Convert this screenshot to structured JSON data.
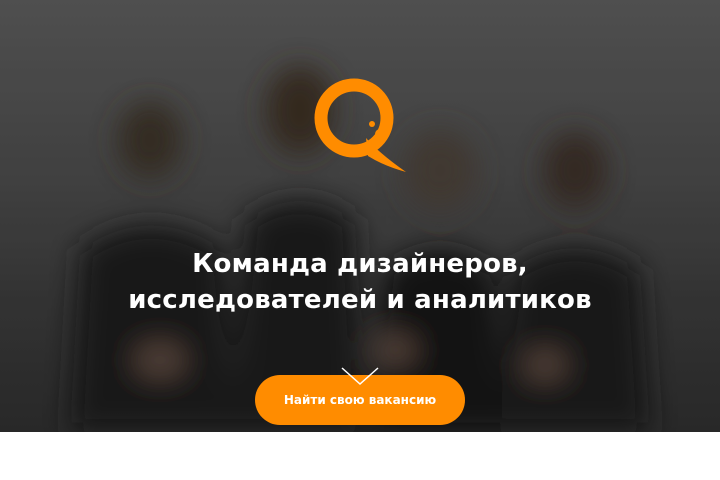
{
  "hero": {
    "headline_line1": "Команда дизайнеров,",
    "headline_line2": "исследователей и аналитиков",
    "cta_label": "Найти свою вакансию"
  },
  "icons": {
    "logo": "qiwi-q-logo-icon",
    "scroll": "chevron-down-icon"
  },
  "colors": {
    "brand_orange": "#ff8c00",
    "text": "#ffffff"
  }
}
